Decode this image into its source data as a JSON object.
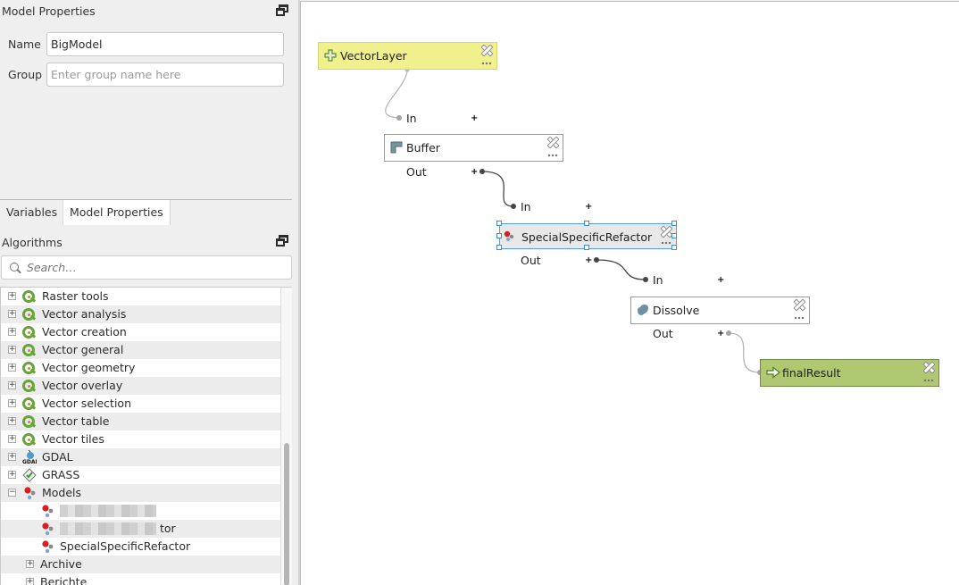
{
  "model_properties_panel": {
    "title": "Model Properties",
    "name_label": "Name",
    "name_value": "BigModel",
    "group_label": "Group",
    "group_value": "",
    "group_placeholder": "Enter group name here"
  },
  "tabs": [
    {
      "label": "Variables",
      "active": false
    },
    {
      "label": "Model Properties",
      "active": true
    }
  ],
  "algorithms_panel": {
    "title": "Algorithms",
    "search_placeholder": "Search…",
    "search_value": "",
    "tree": [
      {
        "label": "Raster tools",
        "icon": "qgis-icon",
        "expander": "+",
        "level": 0
      },
      {
        "label": "Vector analysis",
        "icon": "qgis-icon",
        "expander": "+",
        "level": 0
      },
      {
        "label": "Vector creation",
        "icon": "qgis-icon",
        "expander": "+",
        "level": 0
      },
      {
        "label": "Vector general",
        "icon": "qgis-icon",
        "expander": "+",
        "level": 0
      },
      {
        "label": "Vector geometry",
        "icon": "qgis-icon",
        "expander": "+",
        "level": 0
      },
      {
        "label": "Vector overlay",
        "icon": "qgis-icon",
        "expander": "+",
        "level": 0
      },
      {
        "label": "Vector selection",
        "icon": "qgis-icon",
        "expander": "+",
        "level": 0
      },
      {
        "label": "Vector table",
        "icon": "qgis-icon",
        "expander": "+",
        "level": 0
      },
      {
        "label": "Vector tiles",
        "icon": "qgis-icon",
        "expander": "+",
        "level": 0
      },
      {
        "label": "GDAL",
        "icon": "gdal-icon",
        "expander": "+",
        "level": 0
      },
      {
        "label": "GRASS",
        "icon": "grass-icon",
        "expander": "+",
        "level": 0
      },
      {
        "label": "Models",
        "icon": "model-gears-icon",
        "expander": "−",
        "level": 0
      },
      {
        "label": "",
        "icon": "model-gears-icon",
        "expander": "",
        "level": 1,
        "redacted": true
      },
      {
        "label": "tor",
        "icon": "model-gears-icon",
        "expander": "",
        "level": 1,
        "redacted": true
      },
      {
        "label": "SpecialSpecificRefactor",
        "icon": "model-gears-icon",
        "expander": "",
        "level": 1
      },
      {
        "label": "Archive",
        "icon": "",
        "expander": "+",
        "level": 1
      },
      {
        "label": "Berichte",
        "icon": "",
        "expander": "+",
        "level": 1
      }
    ]
  },
  "canvas": {
    "nodes": [
      {
        "id": "vectorlayer",
        "label": "VectorLayer",
        "kind": "input",
        "icon": "plus-cross-icon",
        "color": "#f0f08c"
      },
      {
        "id": "buffer",
        "label": "Buffer",
        "kind": "algorithm",
        "icon": "buffer-icon",
        "color": "#ffffff",
        "in_label": "In",
        "out_label": "Out"
      },
      {
        "id": "refactor",
        "label": "SpecialSpecificRefactor",
        "kind": "algorithm",
        "icon": "model-gears-icon",
        "color": "#e8e8e8",
        "selected": true,
        "in_label": "In",
        "out_label": "Out"
      },
      {
        "id": "dissolve",
        "label": "Dissolve",
        "kind": "algorithm",
        "icon": "dissolve-icon",
        "color": "#ffffff",
        "in_label": "In",
        "out_label": "Out"
      },
      {
        "id": "finalresult",
        "label": "finalResult",
        "kind": "output",
        "icon": "arrow-right-icon",
        "color": "#b1c873"
      }
    ],
    "links": [
      {
        "from": "vectorlayer",
        "to": "buffer.In"
      },
      {
        "from": "buffer.Out",
        "to": "refactor.In"
      },
      {
        "from": "refactor.Out",
        "to": "dissolve.In"
      },
      {
        "from": "dissolve.Out",
        "to": "finalresult"
      }
    ]
  }
}
